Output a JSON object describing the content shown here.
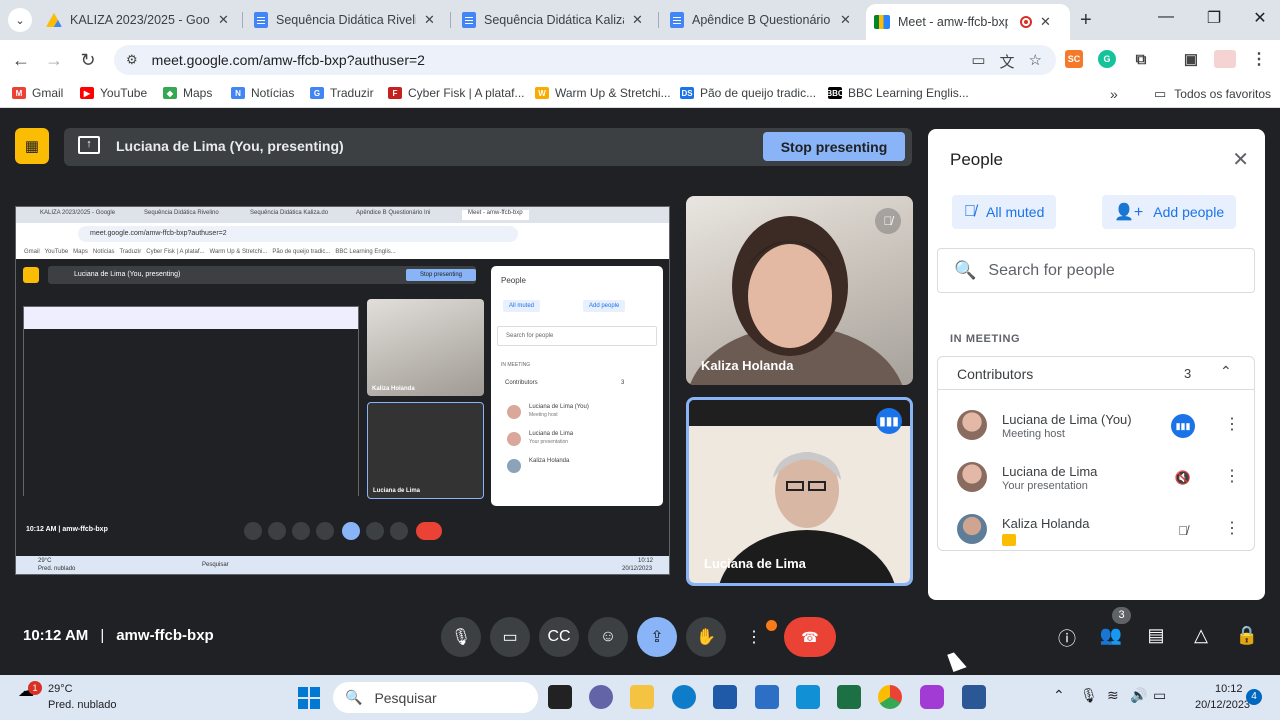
{
  "browser": {
    "tabs": [
      {
        "title": "KALIZA 2023/2025 - Google",
        "favicon": "drive-icon"
      },
      {
        "title": "Sequência Didática Rivelino",
        "favicon": "docs-icon"
      },
      {
        "title": "Sequência Didática Kaliza.do",
        "favicon": "docs-icon"
      },
      {
        "title": "Apêndice B Questionário Ini",
        "favicon": "docs-icon"
      },
      {
        "title": "Meet - amw-ffcb-bxp",
        "favicon": "meet-icon",
        "active": true
      }
    ],
    "url": "meet.google.com/amw-ffcb-bxp?authuser=2",
    "bookmarks": [
      "Gmail",
      "YouTube",
      "Maps",
      "Notícias",
      "Traduzir",
      "Cyber Fisk | A plataf...",
      "Warm Up & Stretchi...",
      "Pão de queijo tradic...",
      "BBC Learning Englis..."
    ],
    "all_bookmarks": "Todos os favoritos"
  },
  "meet": {
    "presenting_text": "Luciana de Lima (You, presenting)",
    "stop_presenting": "Stop presenting",
    "time": "10:12 AM",
    "code": "amw-ffcb-bxp",
    "participant_count": "3",
    "tiles": [
      {
        "name": "Kaliza Holanda",
        "muted": true
      },
      {
        "name": "Luciana de Lima",
        "speaking": true
      }
    ]
  },
  "people_panel": {
    "title": "People",
    "all_muted": "All muted",
    "add_people": "Add people",
    "search_placeholder": "Search for people",
    "section": "IN MEETING",
    "group": {
      "title": "Contributors",
      "count": "3"
    },
    "people": [
      {
        "name": "Luciana de Lima (You)",
        "role": "Meeting host",
        "status": "speaking"
      },
      {
        "name": "Luciana de Lima",
        "role": "Your presentation",
        "status": "muted"
      },
      {
        "name": "Kaliza Holanda",
        "role": "",
        "status": "muted"
      }
    ]
  },
  "nested_view": {
    "url": "meet.google.com/amw-ffcb-bxp?authuser=2",
    "presenting_text": "Luciana de Lima (You, presenting)",
    "stop_presenting": "Stop presenting",
    "people_title": "People",
    "all_muted": "All muted",
    "add_people": "Add people",
    "search_placeholder": "Search for people",
    "section": "IN MEETING",
    "group_title": "Contributors",
    "group_count": "3",
    "people": [
      {
        "name": "Luciana de Lima (You)",
        "role": "Meeting host"
      },
      {
        "name": "Luciana de Lima",
        "role": "Your presentation"
      },
      {
        "name": "Kaliza Holanda",
        "role": ""
      }
    ],
    "tile_kaliza": "Kaliza Holanda",
    "tile_luciana": "Luciana de Lima",
    "time": "10:12 AM",
    "code": "amw-ffcb-bxp",
    "taskbar_temp": "29°C",
    "taskbar_cond": "Pred. nublado",
    "taskbar_search": "Pesquisar",
    "taskbar_time": "10:12",
    "taskbar_date": "20/12/2023"
  },
  "taskbar": {
    "temperature": "29°C",
    "condition": "Pred. nublado",
    "weather_alert": "1",
    "search_label": "Pesquisar",
    "time": "10:12",
    "date": "20/12/2023",
    "notifications": "4"
  },
  "colors": {
    "meet_bg": "#202124",
    "accent": "#8ab4f8",
    "end_call": "#ea4335",
    "present_badge": "#fbbc04"
  }
}
